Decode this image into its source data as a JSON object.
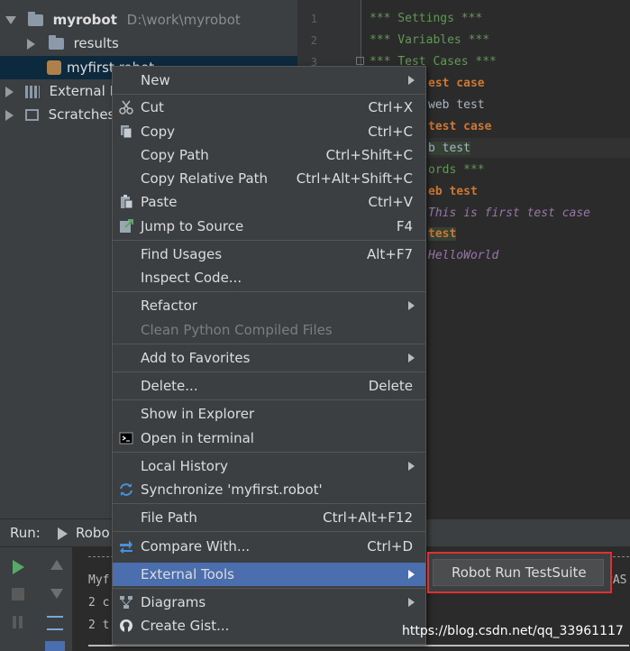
{
  "tree": {
    "project_name": "myrobot",
    "project_path": "D:\\work\\myrobot",
    "results": "results",
    "file": "myfirst.robot",
    "external": "External Li",
    "scratches": "Scratches"
  },
  "editor": {
    "line_numbers": [
      "1",
      "2",
      "3"
    ],
    "lines": [
      "*** Settings ***",
      "*** Variables ***",
      "*** Test Cases ***",
      "est case",
      "web test",
      "test case",
      "b test",
      "ords ***",
      "eb test",
      "This is first test case",
      " test",
      "HelloWorld"
    ]
  },
  "run": {
    "label": "Run:",
    "tab": "Robo",
    "console": [
      "Myf",
      "2 c",
      "2 t"
    ],
    "pas": "PAS"
  },
  "menu": {
    "items": [
      {
        "label": "New",
        "shortcut": ""
      },
      {
        "label": "Cut",
        "shortcut": "Ctrl+X"
      },
      {
        "label": "Copy",
        "shortcut": "Ctrl+C"
      },
      {
        "label": "Copy Path",
        "shortcut": "Ctrl+Shift+C"
      },
      {
        "label": "Copy Relative Path",
        "shortcut": "Ctrl+Alt+Shift+C"
      },
      {
        "label": "Paste",
        "shortcut": "Ctrl+V"
      },
      {
        "label": "Jump to Source",
        "shortcut": "F4"
      },
      {
        "label": "Find Usages",
        "shortcut": "Alt+F7"
      },
      {
        "label": "Inspect Code...",
        "shortcut": ""
      },
      {
        "label": "Refactor",
        "shortcut": ""
      },
      {
        "label": "Clean Python Compiled Files",
        "shortcut": ""
      },
      {
        "label": "Add to Favorites",
        "shortcut": ""
      },
      {
        "label": "Delete...",
        "shortcut": "Delete"
      },
      {
        "label": "Show in Explorer",
        "shortcut": ""
      },
      {
        "label": "Open in terminal",
        "shortcut": ""
      },
      {
        "label": "Local History",
        "shortcut": ""
      },
      {
        "label": "Synchronize 'myfirst.robot'",
        "shortcut": ""
      },
      {
        "label": "File Path",
        "shortcut": "Ctrl+Alt+F12"
      },
      {
        "label": "Compare With...",
        "shortcut": "Ctrl+D"
      },
      {
        "label": "External Tools",
        "shortcut": ""
      },
      {
        "label": "Diagrams",
        "shortcut": ""
      },
      {
        "label": "Create Gist...",
        "shortcut": ""
      }
    ]
  },
  "submenu": {
    "label": "Robot Run TestSuite"
  },
  "watermark": "https://blog.csdn.net/qq_33961117",
  "colors": {
    "highlight": "#4b6eaf",
    "red_box": "#e0302f"
  }
}
